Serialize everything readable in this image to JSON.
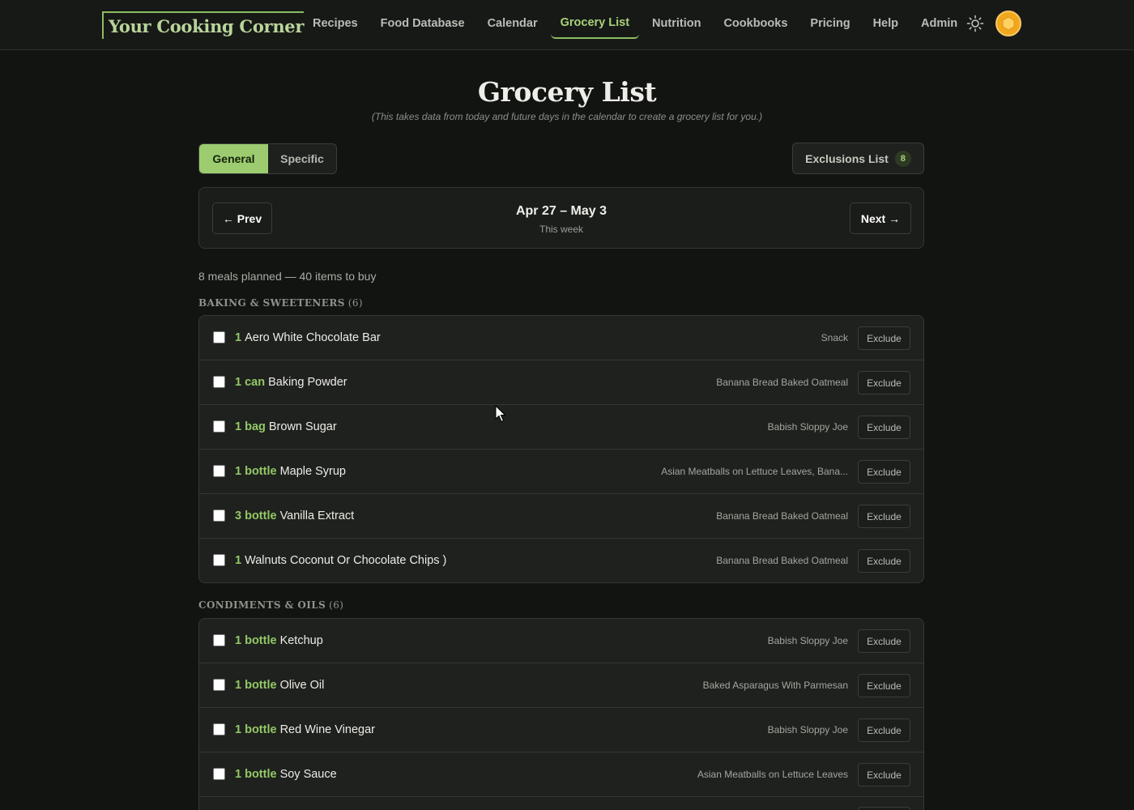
{
  "brand": "Your Cooking Corner",
  "nav": [
    {
      "label": "Recipes",
      "active": false
    },
    {
      "label": "Food Database",
      "active": false
    },
    {
      "label": "Calendar",
      "active": false
    },
    {
      "label": "Grocery List",
      "active": true
    },
    {
      "label": "Nutrition",
      "active": false
    },
    {
      "label": "Cookbooks",
      "active": false
    },
    {
      "label": "Pricing",
      "active": false
    },
    {
      "label": "Help",
      "active": false
    },
    {
      "label": "Admin",
      "active": false
    }
  ],
  "icons": {
    "theme": "sun-icon",
    "avatar": "user-avatar-icon"
  },
  "page": {
    "title": "Grocery List",
    "subtitle": "(This takes data from today and future days in the calendar to create a grocery list for you.)"
  },
  "mode_toggle": {
    "general": "General",
    "specific": "Specific",
    "selected": "General"
  },
  "exclusions": {
    "label": "Exclusions List",
    "count": "8"
  },
  "week": {
    "prev": "← Prev",
    "next": "Next →",
    "range": "Apr 27 – May 3",
    "label": "This week"
  },
  "summary": "8 meals planned — 40 items to buy",
  "exclude_label": "Exclude",
  "categories": [
    {
      "name": "Baking & Sweeteners",
      "count": "(6)",
      "items": [
        {
          "qty": "1",
          "name": "Aero White Chocolate Bar",
          "source": "Snack"
        },
        {
          "qty": "1 can",
          "name": "Baking Powder",
          "source": "Banana Bread Baked Oatmeal"
        },
        {
          "qty": "1 bag",
          "name": "Brown Sugar",
          "source": "Babish Sloppy Joe"
        },
        {
          "qty": "1 bottle",
          "name": "Maple Syrup",
          "source": "Asian Meatballs on Lettuce Leaves, Bana..."
        },
        {
          "qty": "3 bottle",
          "name": "Vanilla Extract",
          "source": "Banana Bread Baked Oatmeal"
        },
        {
          "qty": "1",
          "name": "Walnuts Coconut Or Chocolate Chips )",
          "source": "Banana Bread Baked Oatmeal"
        }
      ]
    },
    {
      "name": "Condiments & Oils",
      "count": "(6)",
      "items": [
        {
          "qty": "1 bottle",
          "name": "Ketchup",
          "source": "Babish Sloppy Joe"
        },
        {
          "qty": "1 bottle",
          "name": "Olive Oil",
          "source": "Baked Asparagus With Parmesan"
        },
        {
          "qty": "1 bottle",
          "name": "Red Wine Vinegar",
          "source": "Babish Sloppy Joe"
        },
        {
          "qty": "1 bottle",
          "name": "Soy Sauce",
          "source": "Asian Meatballs on Lettuce Leaves"
        }
      ]
    }
  ]
}
